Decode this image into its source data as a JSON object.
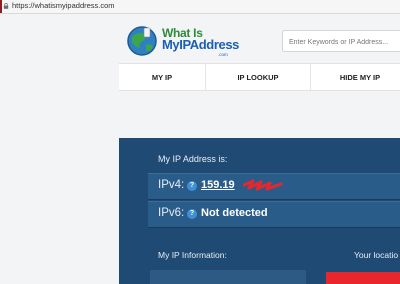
{
  "browser": {
    "url": "https://whatismyipaddress.com"
  },
  "logo": {
    "line1": "What Is",
    "line2": "MyIPAddress",
    "dotcom": ".com"
  },
  "search": {
    "placeholder": "Enter Keywords or IP Address..."
  },
  "nav": {
    "tabs": [
      {
        "label": "MY IP"
      },
      {
        "label": "IP LOOKUP"
      },
      {
        "label": "HIDE MY IP"
      }
    ]
  },
  "ip_panel": {
    "heading": "My IP Address is:",
    "ipv4_label": "IPv4:",
    "ipv4_value": "159.19",
    "ipv6_label": "IPv6:",
    "ipv6_value": "Not detected",
    "help_glyph": "?",
    "info_label": "My IP Information:",
    "location_label": "Your locatio"
  },
  "colors": {
    "panel": "#1f4a73",
    "row": "#2a5c8a",
    "accent_red": "#e8262b",
    "help_blue": "#3e8fd6"
  },
  "icons": {
    "lock": "lock-icon",
    "help": "question-icon",
    "logo_globe": "globe-icon"
  }
}
